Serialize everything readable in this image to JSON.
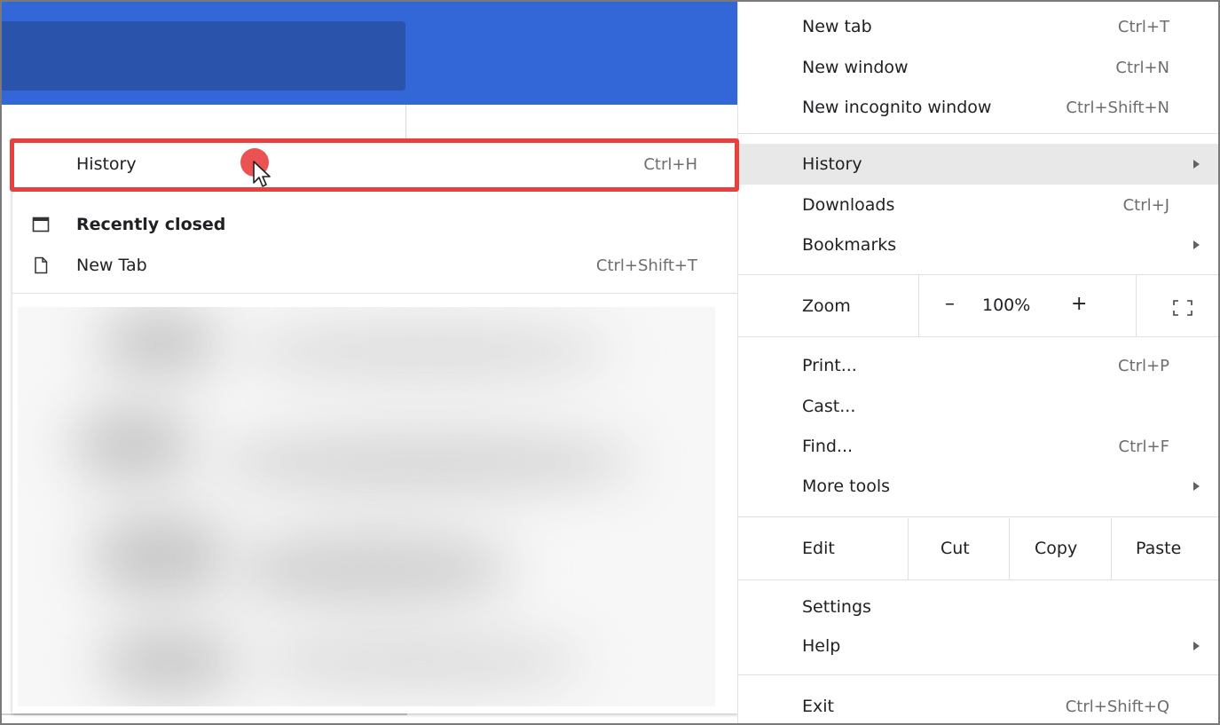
{
  "submenu": {
    "history": {
      "label": "History",
      "shortcut": "Ctrl+H"
    },
    "recently_closed_label": "Recently closed",
    "new_tab": {
      "label": "New Tab",
      "shortcut": "Ctrl+Shift+T"
    }
  },
  "menu": {
    "new_tab": {
      "label": "New tab",
      "shortcut": "Ctrl+T"
    },
    "new_window": {
      "label": "New window",
      "shortcut": "Ctrl+N"
    },
    "new_incognito": {
      "label": "New incognito window",
      "shortcut": "Ctrl+Shift+N"
    },
    "history": {
      "label": "History"
    },
    "downloads": {
      "label": "Downloads",
      "shortcut": "Ctrl+J"
    },
    "bookmarks": {
      "label": "Bookmarks"
    },
    "zoom": {
      "label": "Zoom",
      "minus": "–",
      "value": "100%",
      "plus": "+"
    },
    "print": {
      "label": "Print...",
      "shortcut": "Ctrl+P"
    },
    "cast": {
      "label": "Cast..."
    },
    "find": {
      "label": "Find...",
      "shortcut": "Ctrl+F"
    },
    "more_tools": {
      "label": "More tools"
    },
    "edit": {
      "label": "Edit",
      "cut": "Cut",
      "copy": "Copy",
      "paste": "Paste"
    },
    "settings": {
      "label": "Settings"
    },
    "help": {
      "label": "Help"
    },
    "exit": {
      "label": "Exit",
      "shortcut": "Ctrl+Shift+Q"
    }
  },
  "colors": {
    "header_blue": "#3366d6",
    "omnibox_blue": "#2a53ab",
    "highlight_red": "#e8403f",
    "hover_gray": "#e8e8e8"
  },
  "icons": [
    "window-icon",
    "page-icon",
    "chevron-right-icon",
    "fullscreen-icon",
    "cursor-icon"
  ]
}
